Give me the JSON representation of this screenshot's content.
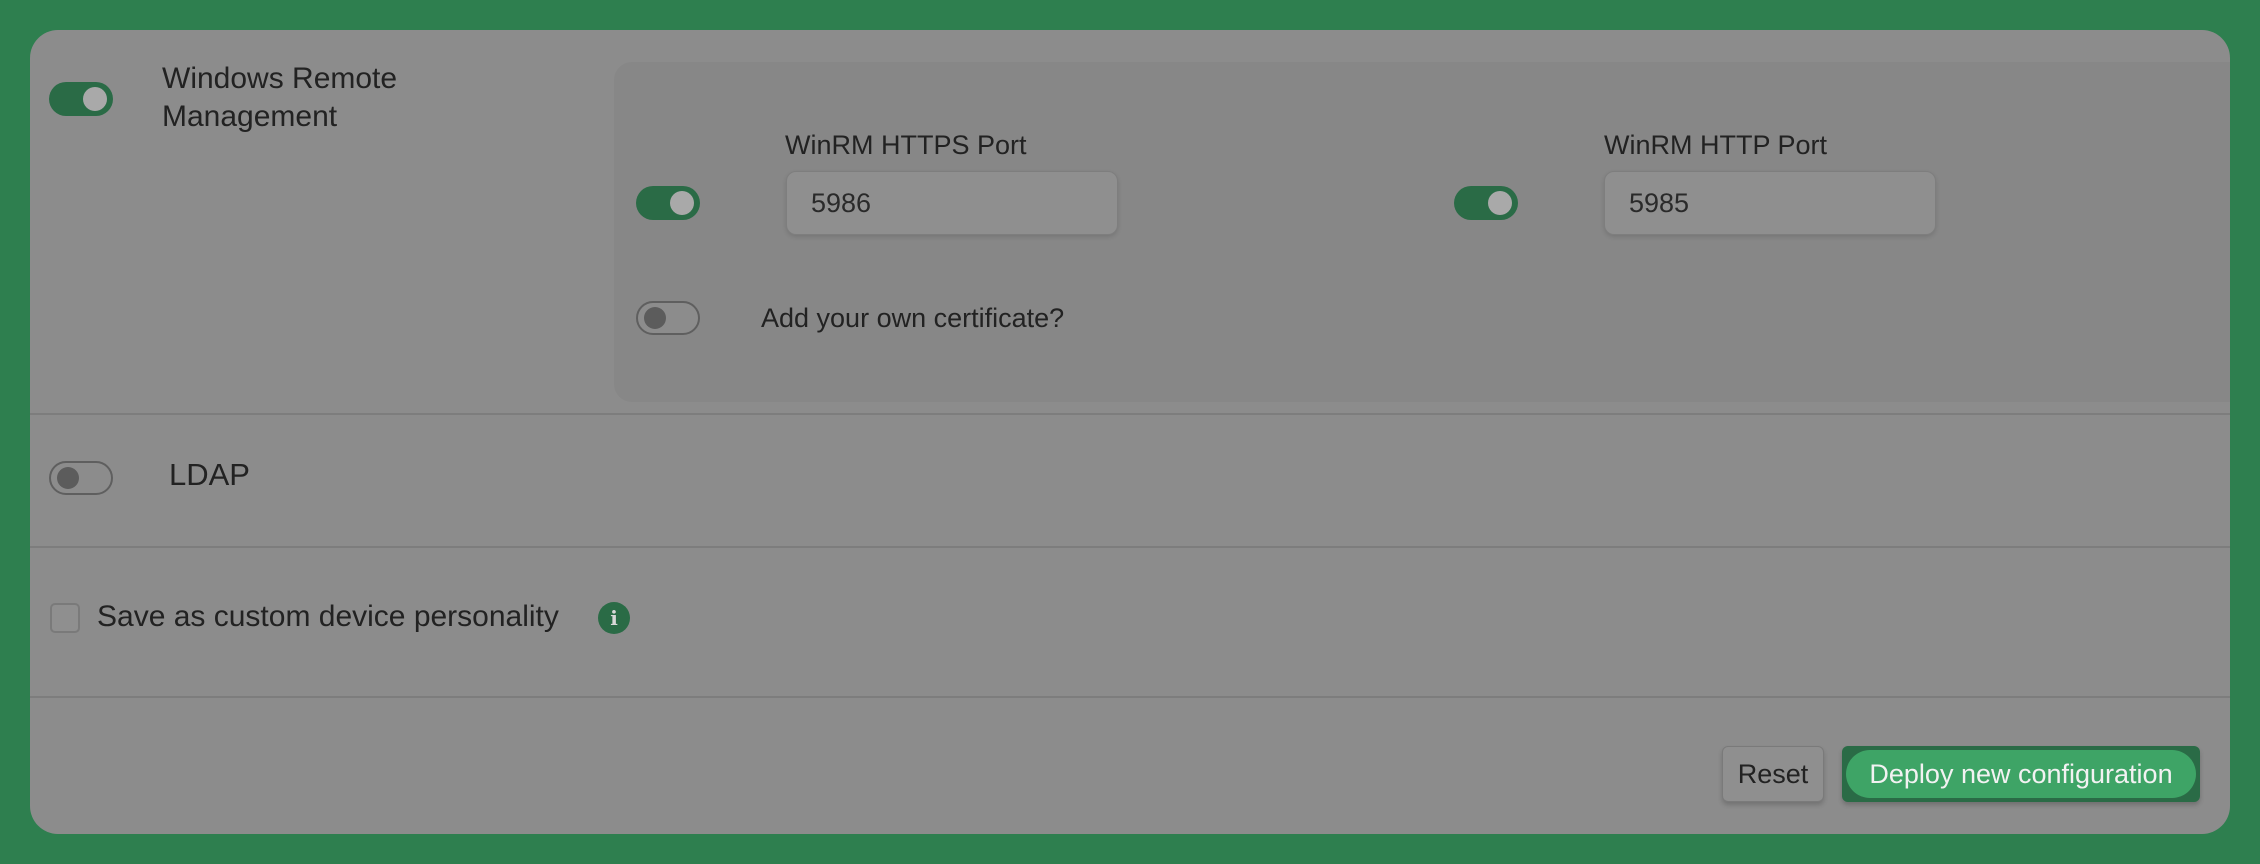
{
  "winrm": {
    "title": "Windows Remote Management",
    "enabled": true,
    "https": {
      "label": "WinRM HTTPS Port",
      "value": "5986",
      "enabled": true
    },
    "http": {
      "label": "WinRM HTTP Port",
      "value": "5985",
      "enabled": true
    },
    "certificate": {
      "label": "Add your own certificate?",
      "enabled": false
    }
  },
  "ldap": {
    "title": "LDAP",
    "enabled": false
  },
  "save_personality": {
    "label": "Save as custom device personality",
    "checked": false,
    "info_icon": "info-icon"
  },
  "actions": {
    "reset_label": "Reset",
    "deploy_label": "Deploy new configuration"
  },
  "colors": {
    "accent": "#2a6b46",
    "accent_light": "#3ea466",
    "background": "#2e7f4f",
    "panel": "#8c8c8c"
  }
}
